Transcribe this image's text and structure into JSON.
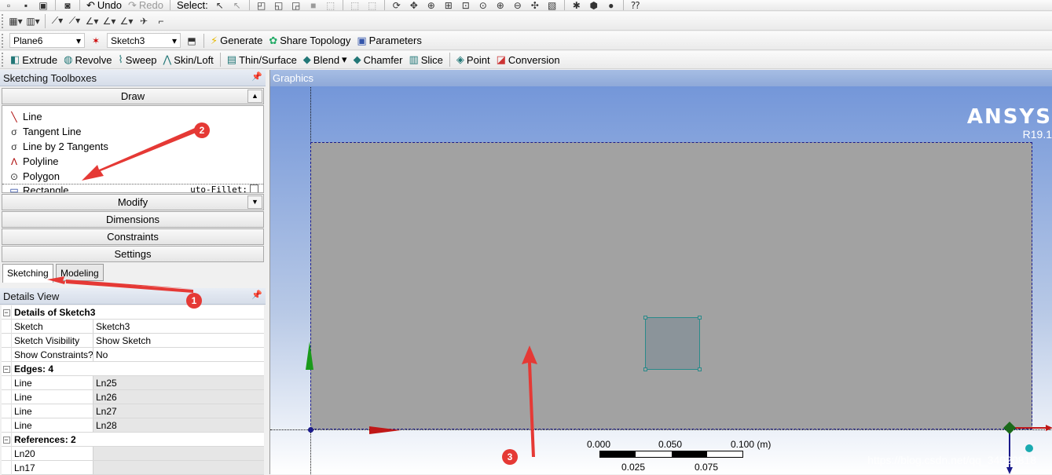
{
  "toolbar1": {
    "undo_label": "Undo",
    "redo_label": "Redo",
    "select_label": "Select:"
  },
  "toolbar3": {
    "plane_value": "Plane6",
    "sketch_value": "Sketch3",
    "generate_label": "Generate",
    "share_topology_label": "Share Topology",
    "parameters_label": "Parameters"
  },
  "toolbar4": {
    "extrude_label": "Extrude",
    "revolve_label": "Revolve",
    "sweep_label": "Sweep",
    "skin_loft_label": "Skin/Loft",
    "thin_surface_label": "Thin/Surface",
    "blend_label": "Blend",
    "chamfer_label": "Chamfer",
    "slice_label": "Slice",
    "point_label": "Point",
    "conversion_label": "Conversion"
  },
  "sketching_toolboxes": {
    "title": "Sketching Toolboxes",
    "draw_label": "Draw",
    "tools": [
      {
        "label": "Line",
        "icon": "line-icon"
      },
      {
        "label": "Tangent Line",
        "icon": "tangent-line-icon"
      },
      {
        "label": "Line by 2 Tangents",
        "icon": "line-by-2-tangents-icon"
      },
      {
        "label": "Polyline",
        "icon": "polyline-icon"
      },
      {
        "label": "Polygon",
        "icon": "polygon-icon"
      },
      {
        "label": "Rectangle",
        "icon": "rectangle-icon"
      }
    ],
    "auto_fillet_label": "uto-Fillet:",
    "modify_label": "Modify",
    "dimensions_label": "Dimensions",
    "constraints_label": "Constraints",
    "settings_label": "Settings",
    "tabs": {
      "sketching": "Sketching",
      "modeling": "Modeling"
    }
  },
  "details_view": {
    "title": "Details View",
    "groups": [
      {
        "title": "Details of Sketch3",
        "rows": [
          {
            "key": "Sketch",
            "value": "Sketch3"
          },
          {
            "key": "Sketch Visibility",
            "value": "Show Sketch"
          },
          {
            "key": "Show Constraints?",
            "value": "No"
          }
        ]
      },
      {
        "title": "Edges: 4",
        "rows": [
          {
            "key": "Line",
            "value": "Ln25"
          },
          {
            "key": "Line",
            "value": "Ln26"
          },
          {
            "key": "Line",
            "value": "Ln27"
          },
          {
            "key": "Line",
            "value": "Ln28"
          }
        ]
      },
      {
        "title": "References: 2",
        "rows": [
          {
            "key": "Ln20",
            "value": ""
          },
          {
            "key": "Ln17",
            "value": ""
          }
        ]
      }
    ]
  },
  "graphics": {
    "title": "Graphics",
    "logo": "ANSYS",
    "version": "R19.1",
    "scale": {
      "top_labels": [
        "0.000",
        "0.050",
        "0.100 (m)"
      ],
      "bottom_labels": [
        "0.025",
        "0.075"
      ]
    },
    "watermark": "https://blog.csdn.net/qq_34020818"
  },
  "annotations": {
    "badge1": "1",
    "badge2": "2",
    "badge3": "3",
    "color": "#e53935"
  }
}
